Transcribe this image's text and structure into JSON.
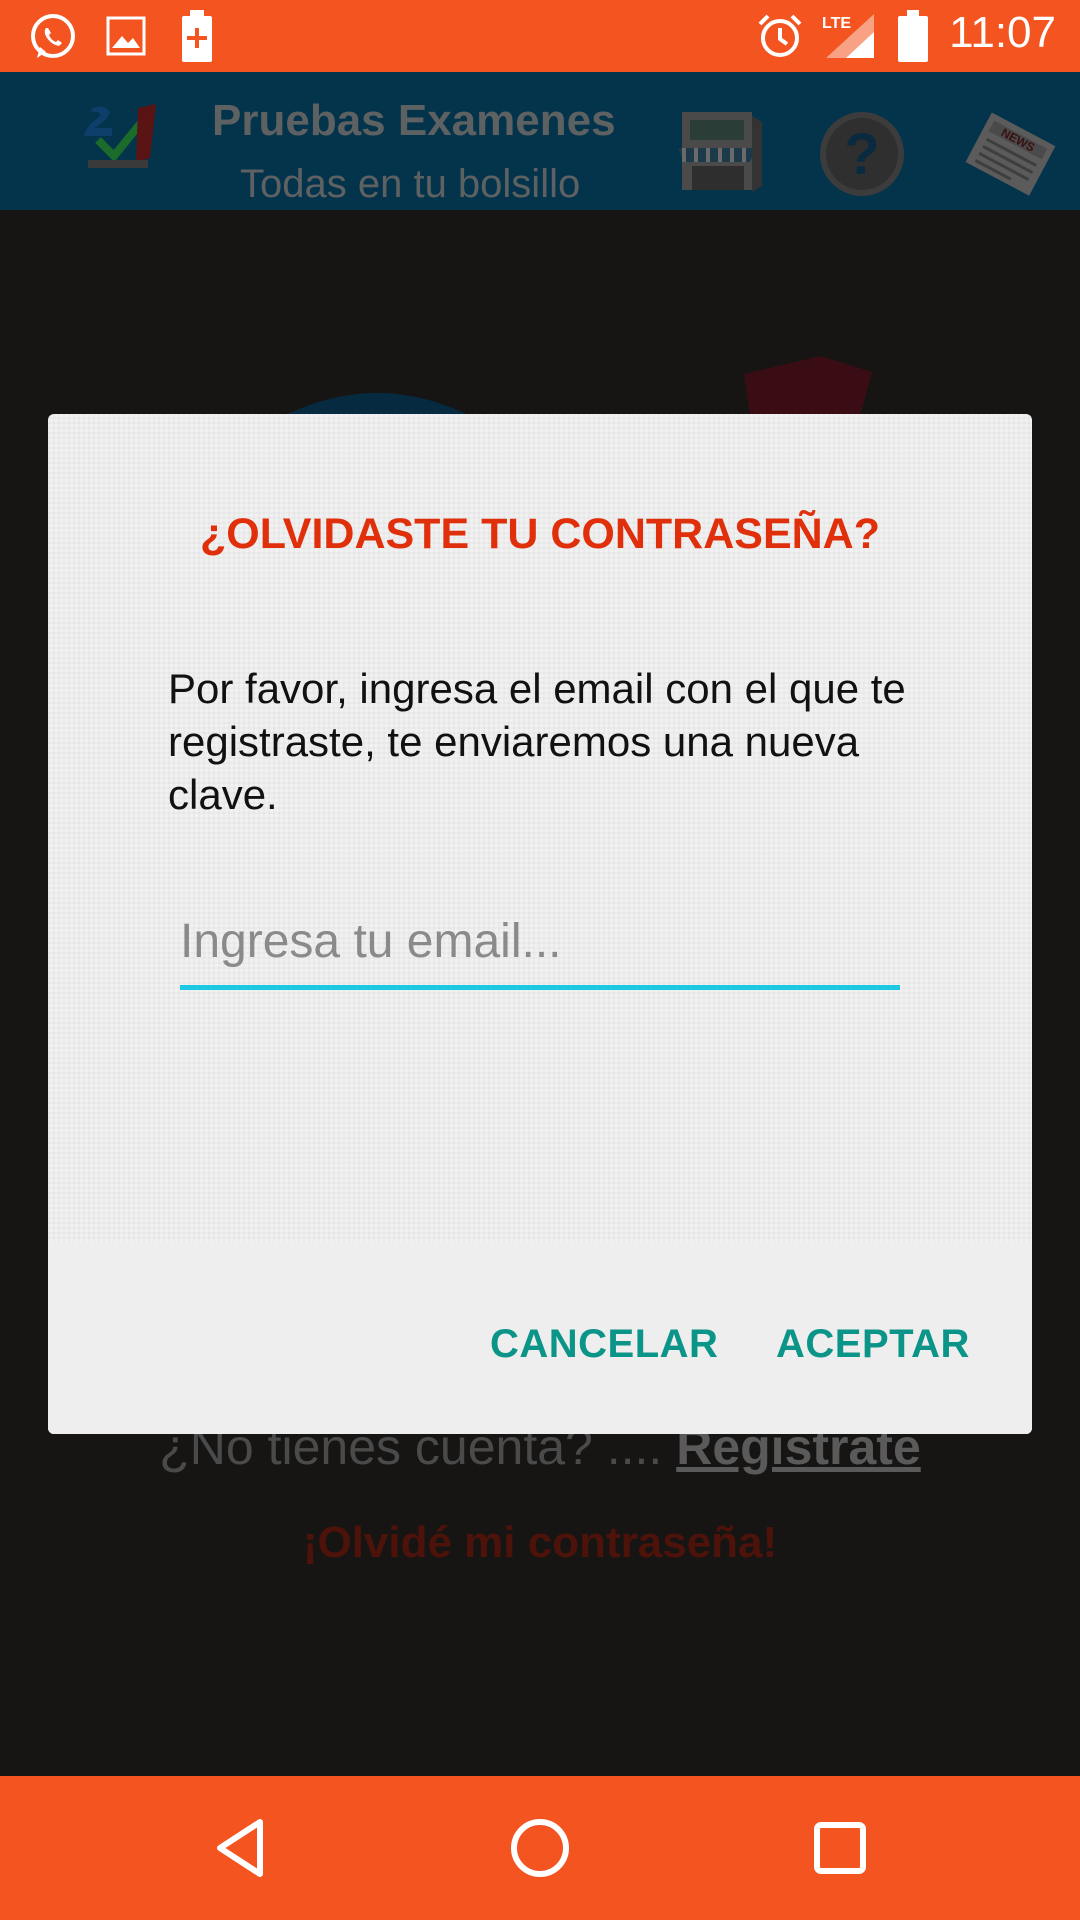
{
  "status_bar": {
    "time": "11:07",
    "icons": [
      "whatsapp-icon",
      "gallery-icon",
      "battery-plus-icon",
      "alarm-icon",
      "lte-signal-icon",
      "battery-icon"
    ]
  },
  "header": {
    "title": "Pruebas Examenes",
    "subtitle": "Todas en tu bolsillo",
    "icons": [
      "app-logo-icon",
      "store-icon",
      "help-icon",
      "news-icon"
    ]
  },
  "background": {
    "register_prompt": "¿No tienes cuenta? ....",
    "register_link": "Registrate",
    "forgot_link": "¡Olvidé mi contraseña!"
  },
  "dialog": {
    "title": "¿OLVIDASTE TU CONTRASEÑA?",
    "message": "Por favor, ingresa el email con el que te registraste, te enviaremos una nueva clave.",
    "email_value": "",
    "email_placeholder": "Ingresa tu email...",
    "cancel_label": "CANCELAR",
    "accept_label": "ACEPTAR"
  },
  "colors": {
    "status_bar": "#f4541f",
    "header": "#04344c",
    "title_red": "#e02f0b",
    "button_teal": "#0b9488",
    "input_underline": "#1cc8e2"
  },
  "nav_bar": {
    "buttons": [
      "back-icon",
      "home-icon",
      "recents-icon"
    ]
  }
}
